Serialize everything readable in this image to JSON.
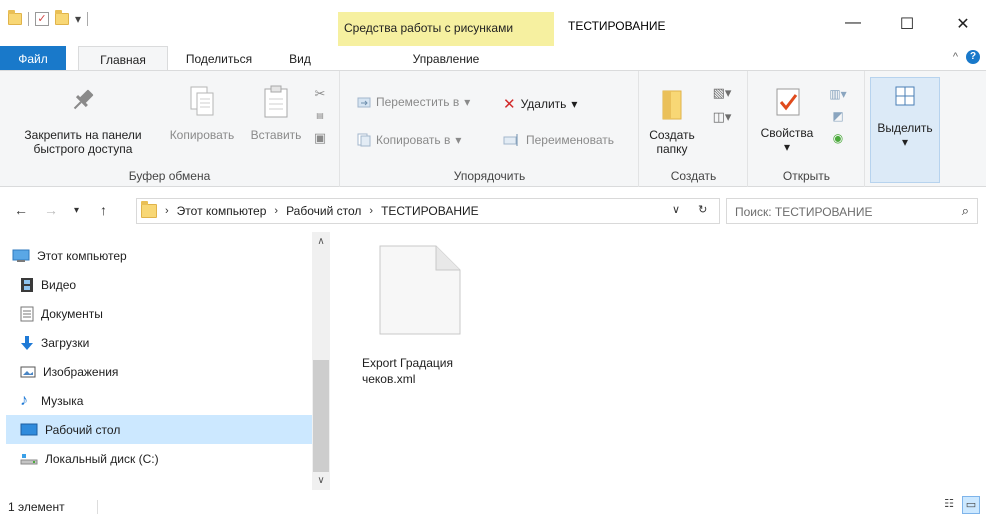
{
  "titlebar": {
    "tools_tab": "Средства работы с рисунками",
    "title": "ТЕСТИРОВАНИЕ",
    "minimize": "—",
    "maximize": "☐",
    "close": "✕"
  },
  "tabs": {
    "file": "Файл",
    "home": "Главная",
    "share": "Поделиться",
    "view": "Вид",
    "manage": "Управление"
  },
  "ribbon": {
    "clipboard": {
      "pin_line1": "Закрепить на панели",
      "pin_line2": "быстрого доступа",
      "copy": "Копировать",
      "paste": "Вставить",
      "label": "Буфер обмена"
    },
    "organize": {
      "move_to": "Переместить в",
      "copy_to": "Копировать в",
      "delete": "Удалить",
      "rename": "Переименовать",
      "label": "Упорядочить"
    },
    "new": {
      "new_folder_line1": "Создать",
      "new_folder_line2": "папку",
      "label": "Создать"
    },
    "open": {
      "properties": "Свойства",
      "label": "Открыть"
    },
    "select": {
      "select": "Выделить"
    }
  },
  "address": {
    "crumbs": [
      "Этот компьютер",
      "Рабочий стол",
      "ТЕСТИРОВАНИЕ"
    ],
    "search_placeholder": "Поиск: ТЕСТИРОВАНИЕ"
  },
  "sidebar": {
    "items": [
      {
        "label": "Этот компьютер",
        "icon": "computer-icon"
      },
      {
        "label": "Видео",
        "icon": "video-icon"
      },
      {
        "label": "Документы",
        "icon": "documents-icon"
      },
      {
        "label": "Загрузки",
        "icon": "downloads-icon"
      },
      {
        "label": "Изображения",
        "icon": "pictures-icon"
      },
      {
        "label": "Музыка",
        "icon": "music-icon"
      },
      {
        "label": "Рабочий стол",
        "icon": "desktop-icon"
      },
      {
        "label": "Локальный диск (C:)",
        "icon": "drive-icon"
      }
    ],
    "selected_index": 6
  },
  "content": {
    "files": [
      {
        "name": "Export Градация чеков.xml",
        "icon": "document-file-icon"
      }
    ]
  },
  "status": {
    "count": "1 элемент"
  },
  "colors": {
    "accent": "#1979ca",
    "tools_tab": "#f6f0a0",
    "selection": "#cce8ff"
  }
}
